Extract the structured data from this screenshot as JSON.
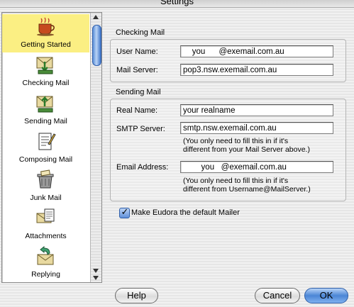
{
  "window": {
    "title": "Settings"
  },
  "sidebar": {
    "items": [
      {
        "label": "Getting Started",
        "icon": "coffee-cup-icon",
        "selected": true
      },
      {
        "label": "Checking Mail",
        "icon": "mail-inbox-icon",
        "selected": false
      },
      {
        "label": "Sending Mail",
        "icon": "mail-send-icon",
        "selected": false
      },
      {
        "label": "Composing Mail",
        "icon": "compose-document-icon",
        "selected": false
      },
      {
        "label": "Junk Mail",
        "icon": "trash-can-icon",
        "selected": false
      },
      {
        "label": "Attachments",
        "icon": "attachment-icon",
        "selected": false
      },
      {
        "label": "Replying",
        "icon": "reply-envelope-icon",
        "selected": false
      }
    ]
  },
  "checking": {
    "title": "Checking Mail",
    "user_name_label": "User Name:",
    "user_name_value": "    you      @exemail.com.au",
    "server_label": "Mail Server:",
    "server_value": "pop3.nsw.exemail.com.au"
  },
  "sending": {
    "title": "Sending Mail",
    "real_name_label": "Real Name:",
    "real_name_value": "your realname",
    "smtp_label": "SMTP Server:",
    "smtp_value": "smtp.nsw.exemail.com.au",
    "smtp_note_line1": "(You only need to fill this in if it's",
    "smtp_note_line2": "different from your Mail Server above.)",
    "email_label": "Email Address:",
    "email_value": "        you   @exemail.com.au",
    "email_note_line1": "(You only need to fill this in if it's",
    "email_note_line2": "different from Username@MailServer.)"
  },
  "default_mailer": {
    "label": "Make Eudora the default Mailer",
    "checked": true
  },
  "buttons": {
    "help": "Help",
    "cancel": "Cancel",
    "ok": "OK"
  },
  "colors": {
    "selection": "#fbef83",
    "accent": "#4b86d6"
  }
}
